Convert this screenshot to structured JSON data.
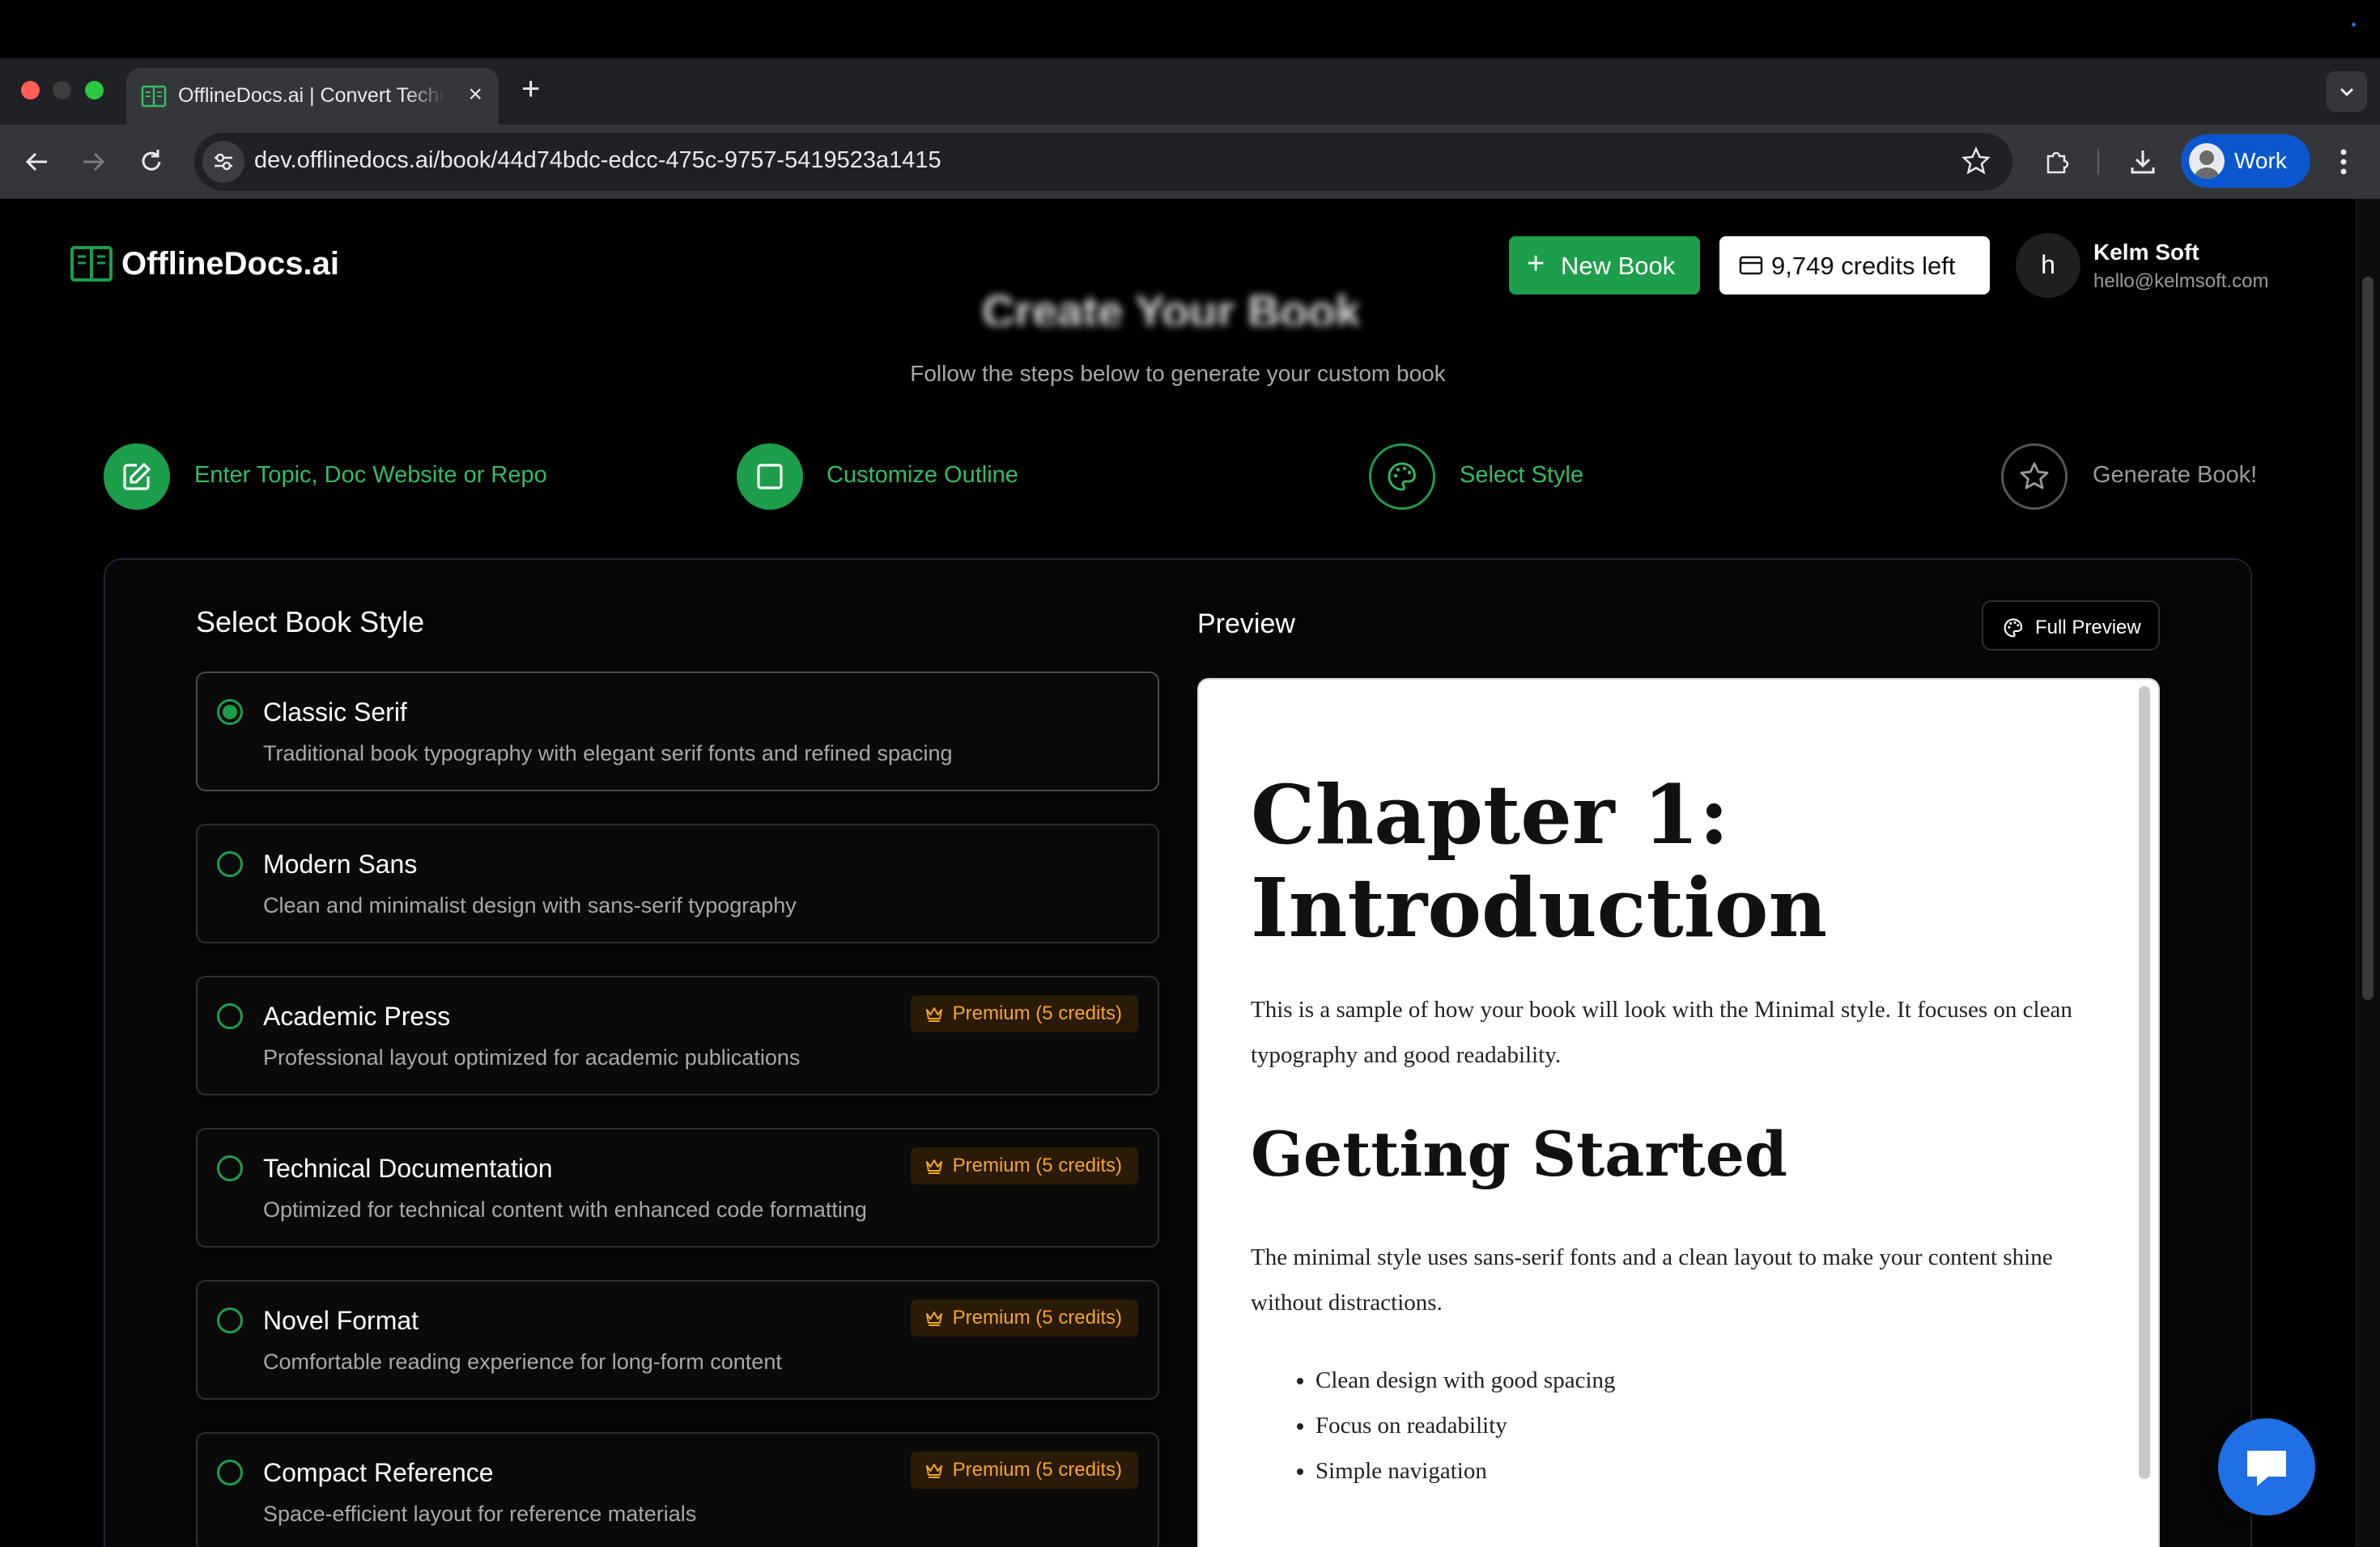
{
  "browser": {
    "tab_title": "OfflineDocs.ai | Convert Technical Docs",
    "new_tab_icon": "plus",
    "url": "dev.offlinedocs.ai/book/44d74bdc-edcc-475c-9757-5419523a1415",
    "profile_label": "Work"
  },
  "header": {
    "logo_text": "OfflineDocs.ai",
    "new_book_label": "New Book",
    "credits_label": "9,749 credits left",
    "user_initial": "h",
    "user_name": "Kelm Soft",
    "user_email": "hello@kelmsoft.com"
  },
  "page": {
    "title": "Create Your Book",
    "subtitle": "Follow the steps below to generate your custom book"
  },
  "steps": [
    {
      "label": "Enter Topic, Doc Website or Repo",
      "state": "complete"
    },
    {
      "label": "Customize Outline",
      "state": "complete"
    },
    {
      "label": "Select Style",
      "state": "current"
    },
    {
      "label": "Generate Book!",
      "state": "upcoming"
    }
  ],
  "style_section": {
    "title": "Select Book Style",
    "options": [
      {
        "name": "Classic Serif",
        "description": "Traditional book typography with elegant serif fonts and refined spacing",
        "selected": true,
        "badge": ""
      },
      {
        "name": "Modern Sans",
        "description": "Clean and minimalist design with sans-serif typography",
        "selected": false,
        "badge": ""
      },
      {
        "name": "Academic Press",
        "description": "Professional layout optimized for academic publications",
        "selected": false,
        "badge": "Premium (5 credits)"
      },
      {
        "name": "Technical Documentation",
        "description": "Optimized for technical content with enhanced code formatting",
        "selected": false,
        "badge": "Premium (5 credits)"
      },
      {
        "name": "Novel Format",
        "description": "Comfortable reading experience for long-form content",
        "selected": false,
        "badge": "Premium (5 credits)"
      },
      {
        "name": "Compact Reference",
        "description": "Space-efficient layout for reference materials",
        "selected": false,
        "badge": "Premium (5 credits)"
      }
    ]
  },
  "preview": {
    "title": "Preview",
    "full_preview_label": "Full Preview",
    "chapter_heading": "Chapter 1: Introduction",
    "intro_paragraph": "This is a sample of how your book will look with the Minimal style. It focuses on clean typography and good readability.",
    "section_heading": "Getting Started",
    "section_paragraph": "The minimal style uses sans-serif fonts and a clean layout to make your content shine without distractions.",
    "bullets": [
      "Clean design with good spacing",
      "Focus on readability",
      "Simple navigation"
    ]
  },
  "colors": {
    "accent_green": "#1d9e4b",
    "premium_text": "#f5a524",
    "chat_blue": "#1f6fe5"
  }
}
